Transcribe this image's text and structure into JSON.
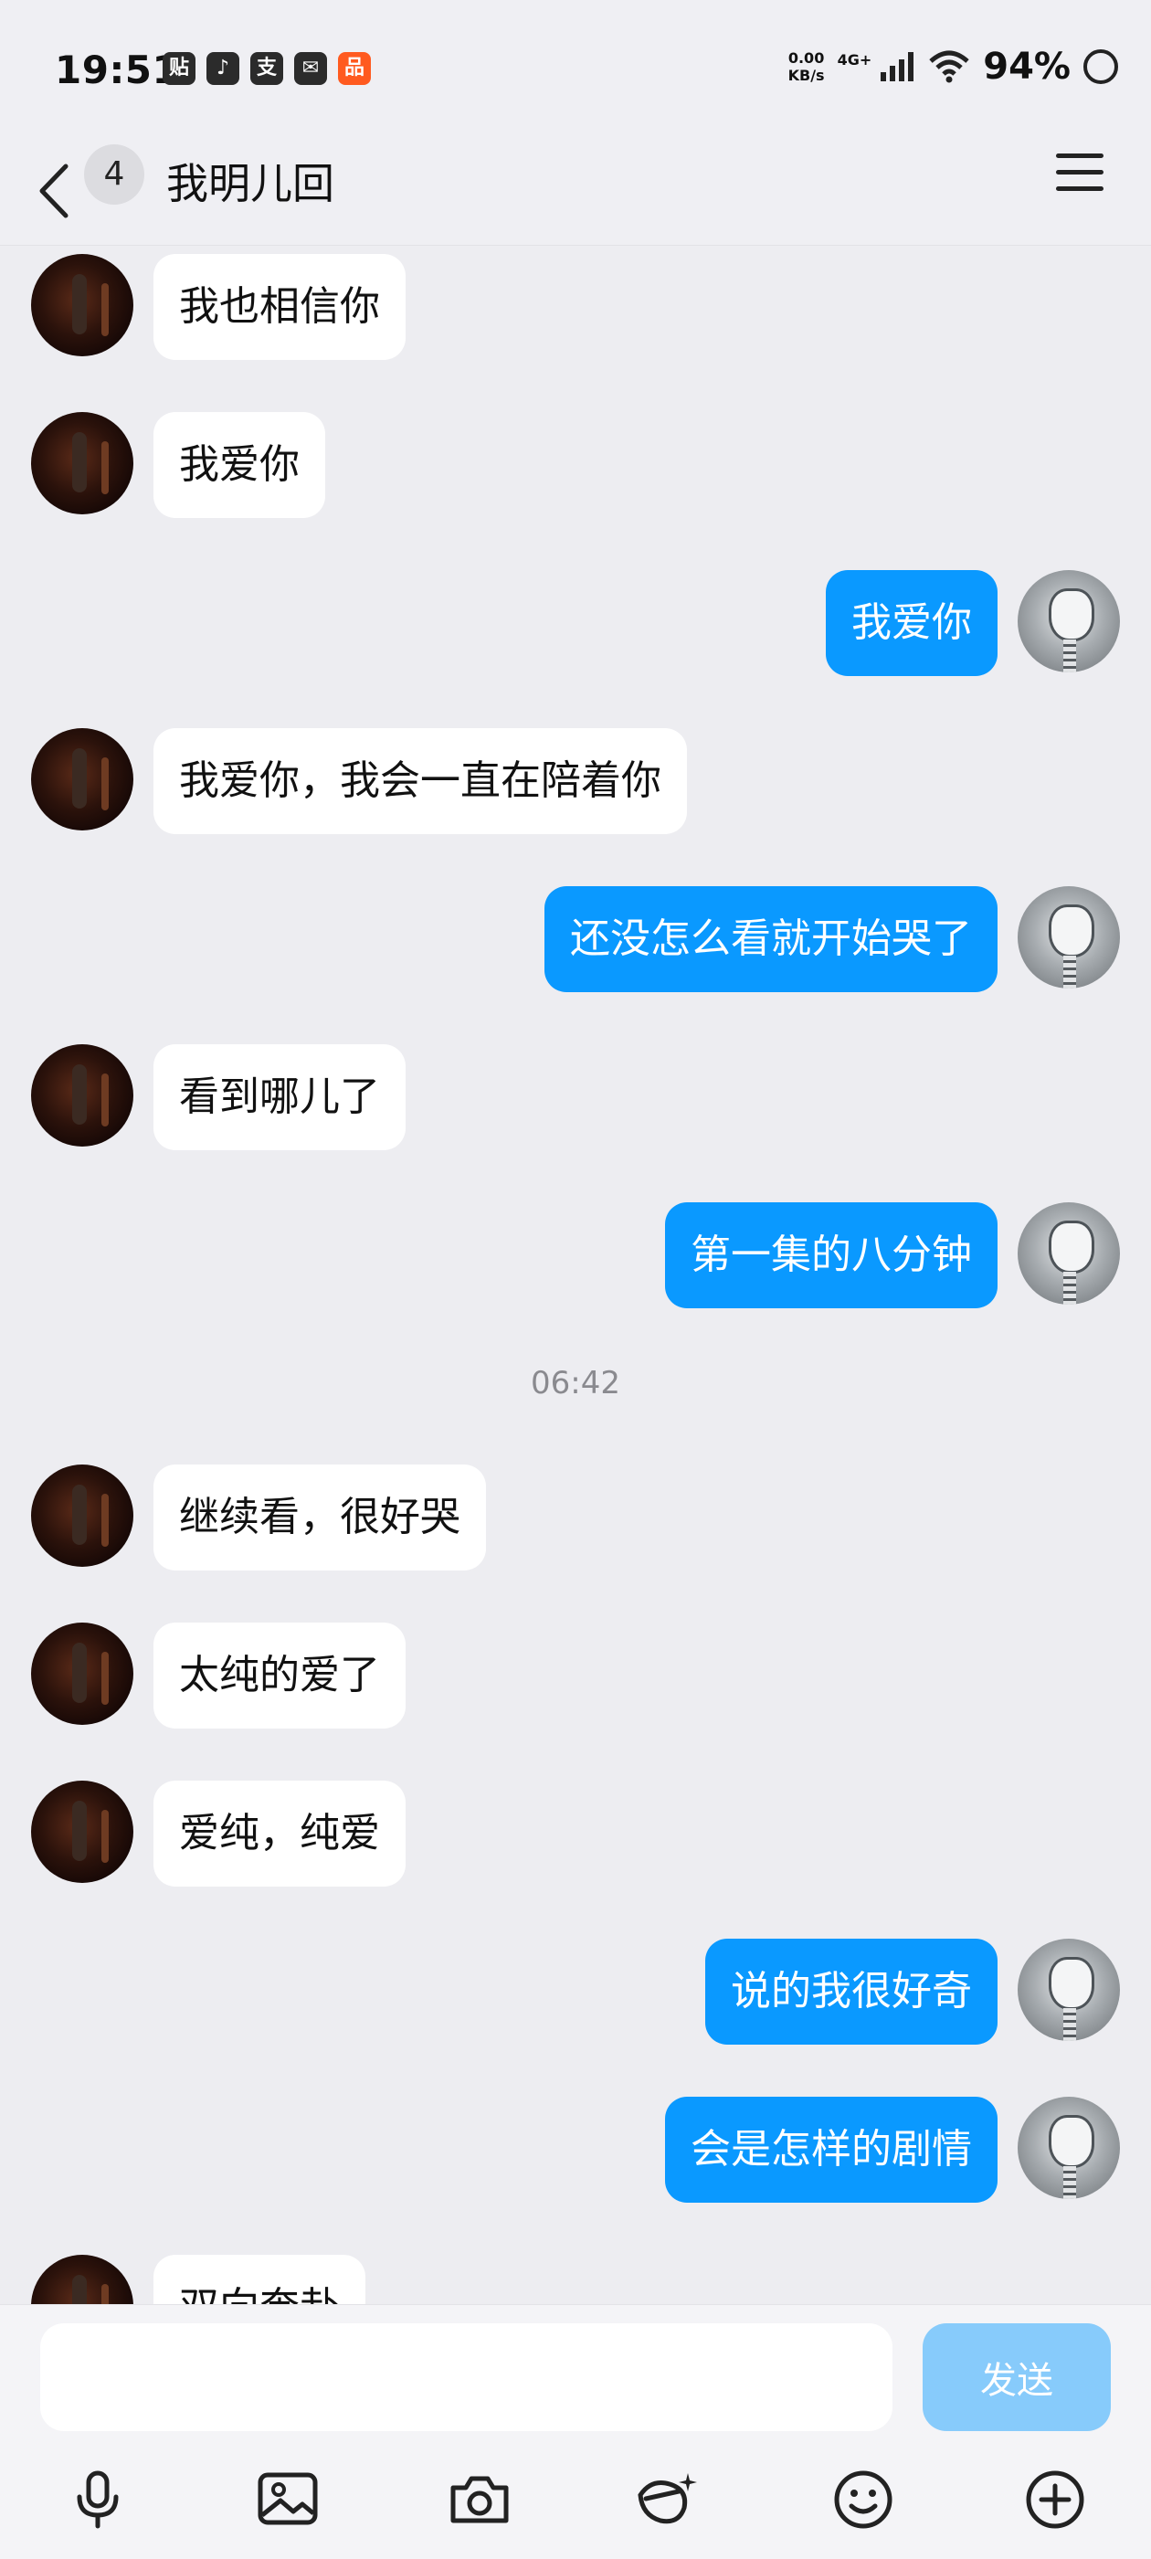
{
  "status_bar": {
    "time": "19:51",
    "app_icons": [
      "贴",
      "♪",
      "支",
      "✉",
      "品"
    ],
    "net_speed_value": "0.00",
    "net_speed_unit": "KB/s",
    "network": "4G+",
    "battery": "94%"
  },
  "header": {
    "unread_count": "4",
    "title": "我明儿回"
  },
  "messages": [
    {
      "from": "them",
      "text": "我也相信你"
    },
    {
      "from": "them",
      "text": "我爱你"
    },
    {
      "from": "me",
      "text": "我爱你"
    },
    {
      "from": "them",
      "text": "我爱你，我会一直在陪着你"
    },
    {
      "from": "me",
      "text": "还没怎么看就开始哭了"
    },
    {
      "from": "them",
      "text": "看到哪儿了"
    },
    {
      "from": "me",
      "text": "第一集的八分钟"
    },
    {
      "from": "them",
      "text": "继续看，很好哭"
    },
    {
      "from": "them",
      "text": "太纯的爱了"
    },
    {
      "from": "them",
      "text": "爱纯，纯爱"
    },
    {
      "from": "me",
      "text": "说的我很好奇"
    },
    {
      "from": "me",
      "text": "会是怎样的剧情"
    },
    {
      "from": "them",
      "text": "双向奔赴"
    }
  ],
  "timestamp": "06:42",
  "composer": {
    "input_value": "",
    "send_label": "发送"
  },
  "toolbar_icons": [
    "microphone-icon",
    "image-icon",
    "camera-icon",
    "sticker-icon",
    "emoji-icon",
    "plus-icon"
  ],
  "colors": {
    "my_bubble": "#0a99ff",
    "their_bubble": "#ffffff",
    "send_button_disabled": "#87cbfb",
    "background": "#ededf1"
  }
}
